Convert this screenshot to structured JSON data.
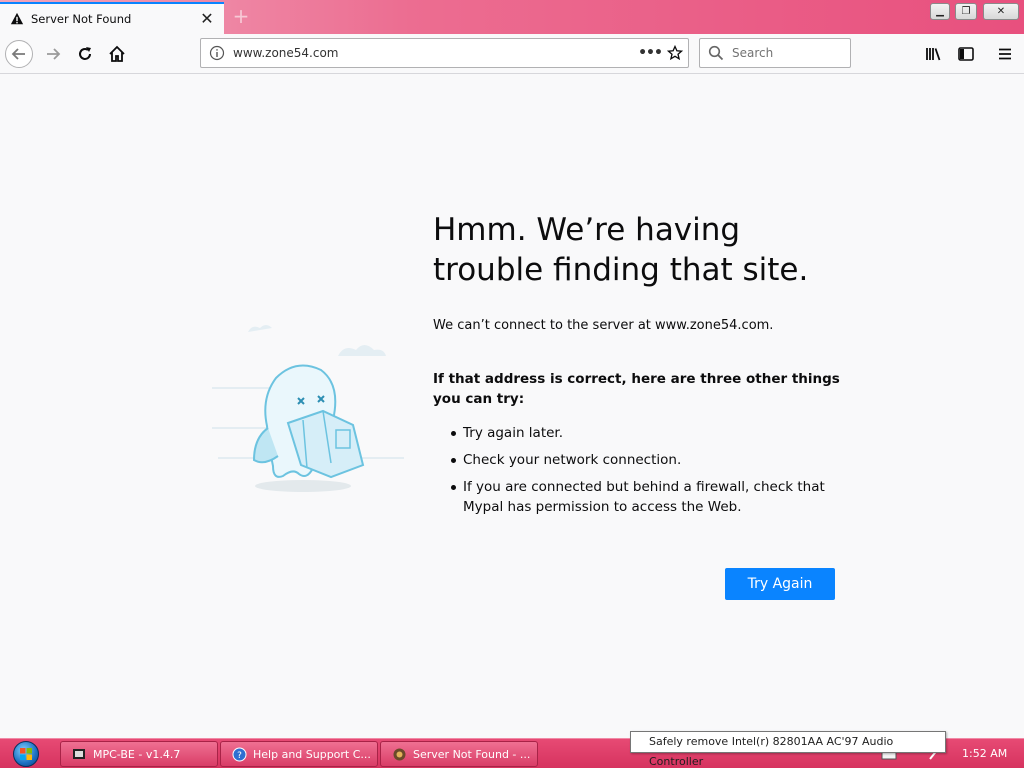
{
  "window": {
    "tab_title": "Server Not Found",
    "tab_icon": "warning-icon",
    "new_tab_icon": "plus-icon"
  },
  "toolbar": {
    "url": "www.zone54.com",
    "page_actions": "•••",
    "search_placeholder": "Search"
  },
  "error_page": {
    "title": "Hmm. We’re having trouble finding that site.",
    "description": "We can’t connect to the server at www.zone54.com.",
    "suggestion_heading": "If that address is correct, here are three other things you can try:",
    "suggestions": [
      "Try again later.",
      "Check your network connection.",
      "If you are connected but behind a firewall, check that Mypal has permission to access the Web."
    ],
    "button_label": "Try Again",
    "accent_color": "#0a84ff"
  },
  "taskbar": {
    "items": [
      {
        "label": "MPC-BE - v1.4.7",
        "icon": "film-icon"
      },
      {
        "label": "Help and Support C...",
        "icon": "help-icon"
      },
      {
        "label": "Server Not Found - ...",
        "icon": "browser-icon"
      }
    ],
    "clock": "1:52 AM",
    "tooltip": "Safely remove Intel(r) 82801AA AC'97 Audio Controller",
    "color": "#e74a74"
  }
}
